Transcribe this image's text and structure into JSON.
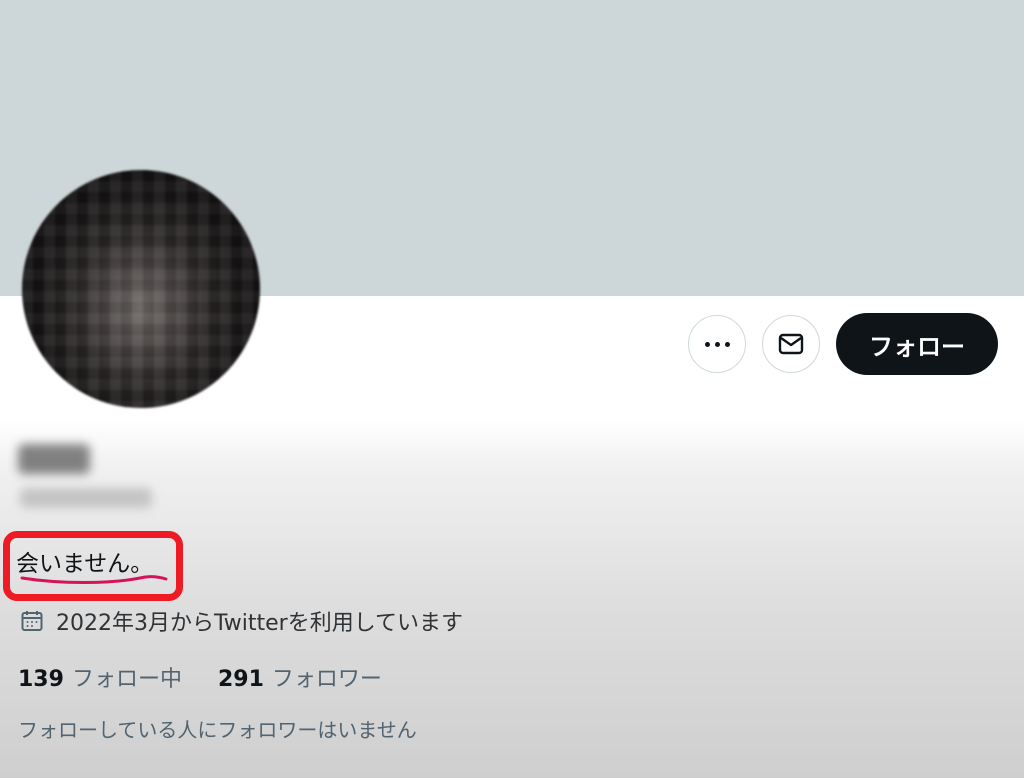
{
  "profile": {
    "bio": "会いません。",
    "joined_text": "2022年3月からTwitterを利用しています",
    "following_count": "139",
    "following_label": "フォロー中",
    "followers_count": "291",
    "followers_label": "フォロワー",
    "known_followers_text": "フォローしている人にフォロワーはいません"
  },
  "actions": {
    "more_icon": "more-horizontal-icon",
    "message_icon": "envelope-icon",
    "follow_label": "フォロー"
  },
  "colors": {
    "banner": "#cdd6d8",
    "highlight": "#ee1b24",
    "button_dark": "#0f1419"
  }
}
